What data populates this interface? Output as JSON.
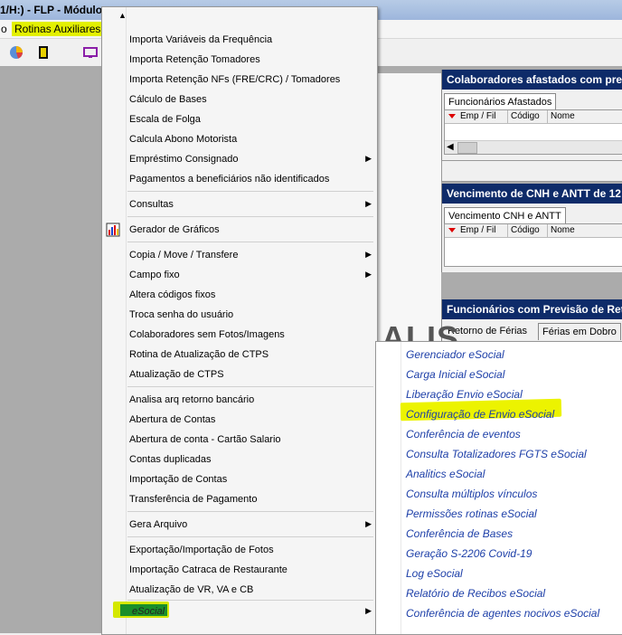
{
  "titlebar": {
    "title": "1/H:) - FLP - Módulo"
  },
  "menubar": {
    "left_item": "o",
    "rotinas": "Rotinas Auxiliares"
  },
  "panels": [
    {
      "title": "Colaboradores afastados com previ",
      "tab": "Funcionários Afastados",
      "cols": [
        "Emp / Fil",
        "Código",
        "Nome"
      ]
    },
    {
      "title": "Vencimento de CNH e ANTT de 12",
      "tab": "Vencimento CNH e ANTT",
      "cols": [
        "Emp / Fil",
        "Código",
        "Nome"
      ]
    },
    {
      "title": "Funcionários com Previsão de Ret",
      "tab": "Retorno de Férias",
      "tab2": "Férias em Dobro"
    }
  ],
  "bg_text": "ALIS",
  "menu": {
    "items": [
      "Importa Variáveis da Frequência",
      "Importa Retenção Tomadores",
      "Importa Retenção NFs (FRE/CRC) / Tomadores",
      "Cálculo de Bases",
      "Escala de Folga",
      "Calcula Abono Motorista",
      "Empréstimo Consignado",
      "Pagamentos a beneficiários não identificados",
      "Consultas",
      "Gerador de Gráficos",
      "Copia / Move / Transfere",
      "Campo fixo",
      "Altera códigos fixos",
      "Troca senha do usuário",
      "Colaboradores sem Fotos/Imagens",
      "Rotina de Atualização de CTPS",
      "Atualização de CTPS",
      "Analisa arq retorno bancário",
      "Abertura de Contas",
      "Abertura de conta - Cartão Salario",
      "Contas duplicadas",
      "Importação de Contas",
      "Transferência de Pagamento",
      "Gera Arquivo",
      "Exportação/Importação de Fotos",
      "Importação Catraca de Restaurante",
      "Atualização de VR, VA e CB",
      "eSocial"
    ]
  },
  "submenu": {
    "items": [
      "Gerenciador eSocial",
      "Carga Inicial eSocial",
      "Liberação Envio eSocial",
      "Configuração de Envio eSocial",
      "Conferência de eventos",
      "Consulta Totalizadores FGTS eSocial",
      "Analitics eSocial",
      "Consulta múltiplos vínculos",
      "Permissões rotinas eSocial",
      "Conferência de Bases",
      "Geração S-2206 Covid-19",
      "Log eSocial",
      "Relatório de Recibos eSocial",
      "Conferência de agentes nocivos eSocial"
    ]
  }
}
